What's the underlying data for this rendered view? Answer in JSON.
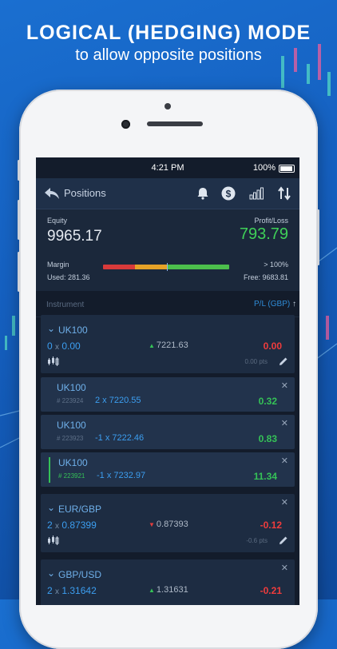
{
  "headline": {
    "title": "LOGICAL (HEDGING) MODE",
    "subtitle": "to allow opposite positions"
  },
  "status_bar": {
    "time": "4:21 PM",
    "battery": "100%"
  },
  "nav": {
    "title": "Positions",
    "icons": [
      "back-arrow-icon",
      "bell-icon",
      "dollar-icon",
      "signal-bars-icon",
      "sort-arrows-icon"
    ]
  },
  "summary": {
    "equity_label": "Equity",
    "equity_value": "9965.17",
    "pl_label": "Profit/Loss",
    "pl_value": "793.79",
    "margin_label": "Margin",
    "margin_used": "Used: 281.36",
    "margin_pct": "> 100%",
    "margin_free": "Free: 9683.81"
  },
  "columns": {
    "instrument": "Instrument",
    "pl": "P/L (GBP)"
  },
  "groups": [
    {
      "name": "UK100",
      "qty": "0",
      "avg_price": "0.00",
      "market_price": "7221.63",
      "pl": "0.00",
      "pts": "0.00 pts",
      "positions": [
        {
          "name": "UK100",
          "ticket": "# 223924",
          "trade": "2 x 7220.55",
          "pl": "0.32"
        },
        {
          "name": "UK100",
          "ticket": "# 223923",
          "trade": "-1 x 7222.46",
          "pl": "0.83"
        },
        {
          "name": "UK100",
          "ticket": "# 223921",
          "trade": "-1 x 7232.97",
          "pl": "11.34"
        }
      ]
    },
    {
      "name": "EUR/GBP",
      "qty": "2",
      "avg_price": "0.87399",
      "market_price": "0.87393",
      "pl": "-0.12",
      "pts": "-0.6 pts"
    },
    {
      "name": "GBP/USD",
      "qty": "2",
      "avg_price": "1.31642",
      "market_price": "1.31631",
      "pl": "-0.21"
    }
  ],
  "colors": {
    "background": "#1565c0",
    "profit_green": "#3fd058",
    "loss_red": "#f03c3c",
    "accent_blue": "#3c9ef0"
  }
}
